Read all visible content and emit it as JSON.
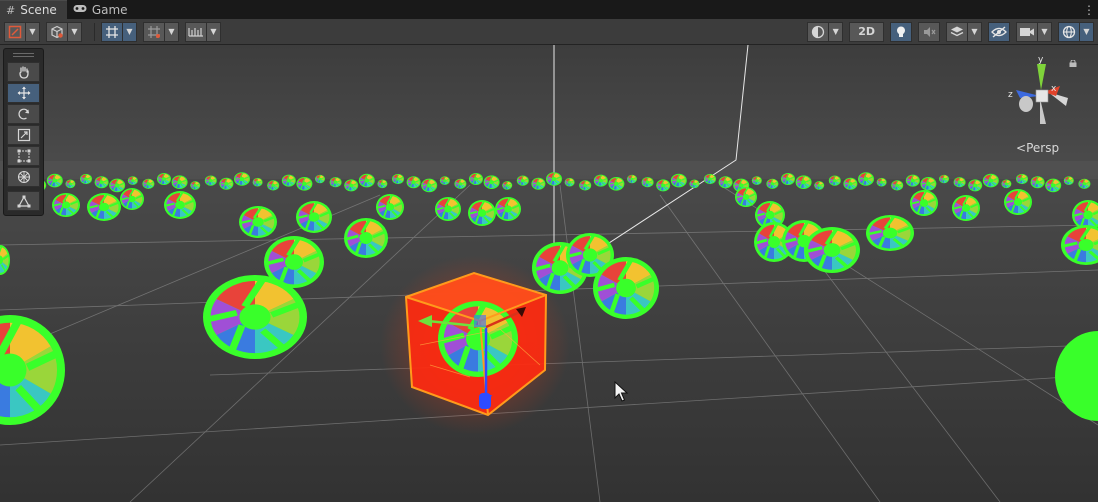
{
  "tabs": [
    {
      "label": "Scene",
      "icon": "grid-icon",
      "active": true
    },
    {
      "label": "Game",
      "icon": "gamepad-icon",
      "active": false
    }
  ],
  "toolbar": {
    "mode_2d": "2D"
  },
  "palette": {
    "tools": [
      "hand-tool",
      "move-tool",
      "rotate-tool",
      "scale-tool",
      "rect-tool",
      "transform-tool",
      "custom-tool"
    ],
    "selected": "move-tool"
  },
  "gizmo": {
    "axis_y": "y",
    "axis_x": "x",
    "axis_z": "z",
    "projection": "Persp"
  },
  "colors": {
    "highlight_green": "#39ff2a",
    "selected_cube": "#ff2a10",
    "cube_outline": "#ff9a1c",
    "toolbar_selected": "#46607c"
  }
}
